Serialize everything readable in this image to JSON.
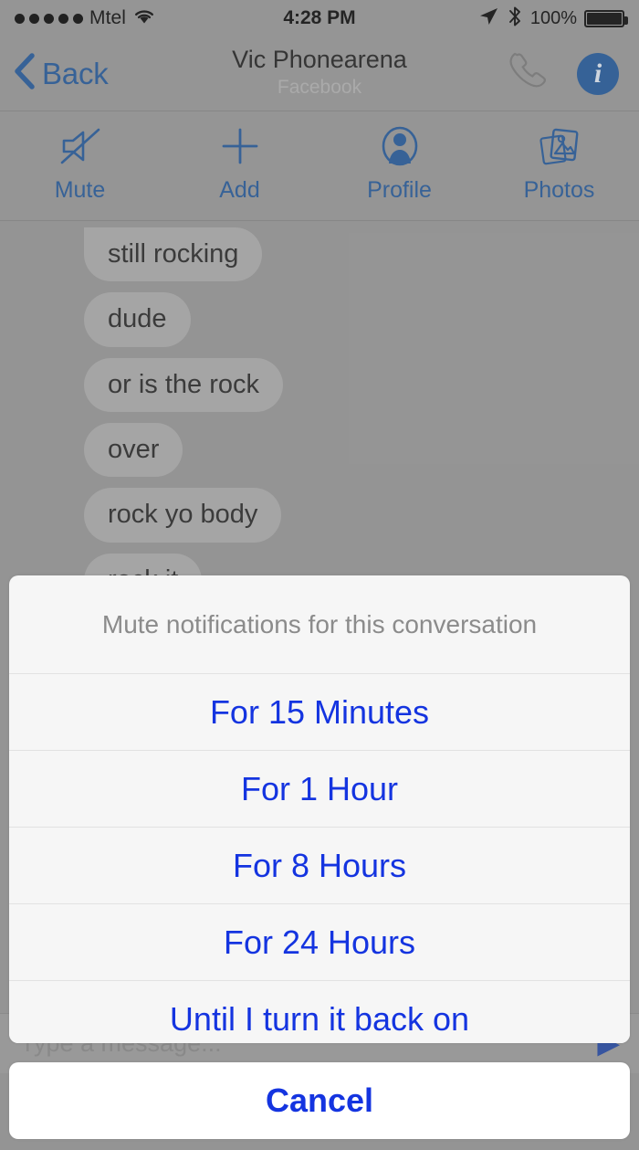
{
  "status_bar": {
    "signal_dots": 5,
    "carrier": "Mtel",
    "wifi_icon": "wifi-icon",
    "time": "4:28 PM",
    "location_icon": "location-arrow-icon",
    "bluetooth_icon": "bluetooth-icon",
    "battery_percent": "100%",
    "battery_icon": "battery-full-icon"
  },
  "nav_bar": {
    "back_label": "Back",
    "back_icon": "chevron-left-icon",
    "title": "Vic Phonearena",
    "subtitle": "Facebook",
    "call_icon": "phone-handset-icon",
    "info_label": "i",
    "info_icon": "info-circle-icon"
  },
  "toolbar": {
    "items": [
      {
        "label": "Mute",
        "icon": "speaker-mute-icon"
      },
      {
        "label": "Add",
        "icon": "plus-icon"
      },
      {
        "label": "Profile",
        "icon": "person-circle-icon"
      },
      {
        "label": "Photos",
        "icon": "photos-stack-icon"
      }
    ]
  },
  "chat": {
    "messages": [
      {
        "text": "still rocking"
      },
      {
        "text": "dude"
      },
      {
        "text": "or is the rock"
      },
      {
        "text": "over"
      },
      {
        "text": "rock yo body"
      },
      {
        "text": "rock it"
      }
    ]
  },
  "input_bar": {
    "placeholder": "Type a message...",
    "send_icon": "send-arrow-icon"
  },
  "action_sheet": {
    "title": "Mute notifications for this conversation",
    "options": [
      {
        "label": "For 15 Minutes"
      },
      {
        "label": "For 1 Hour"
      },
      {
        "label": "For 8 Hours"
      },
      {
        "label": "For 24 Hours"
      },
      {
        "label": "Until I turn it back on"
      }
    ],
    "cancel_label": "Cancel"
  },
  "colors": {
    "accent_blue": "#1434e0",
    "nav_blue": "#2c5f9e",
    "background_gray": "#9a9a9a",
    "sheet_bg": "#f6f6f6",
    "cancel_bg": "#ffffff",
    "title_gray": "#8b8b8b"
  }
}
